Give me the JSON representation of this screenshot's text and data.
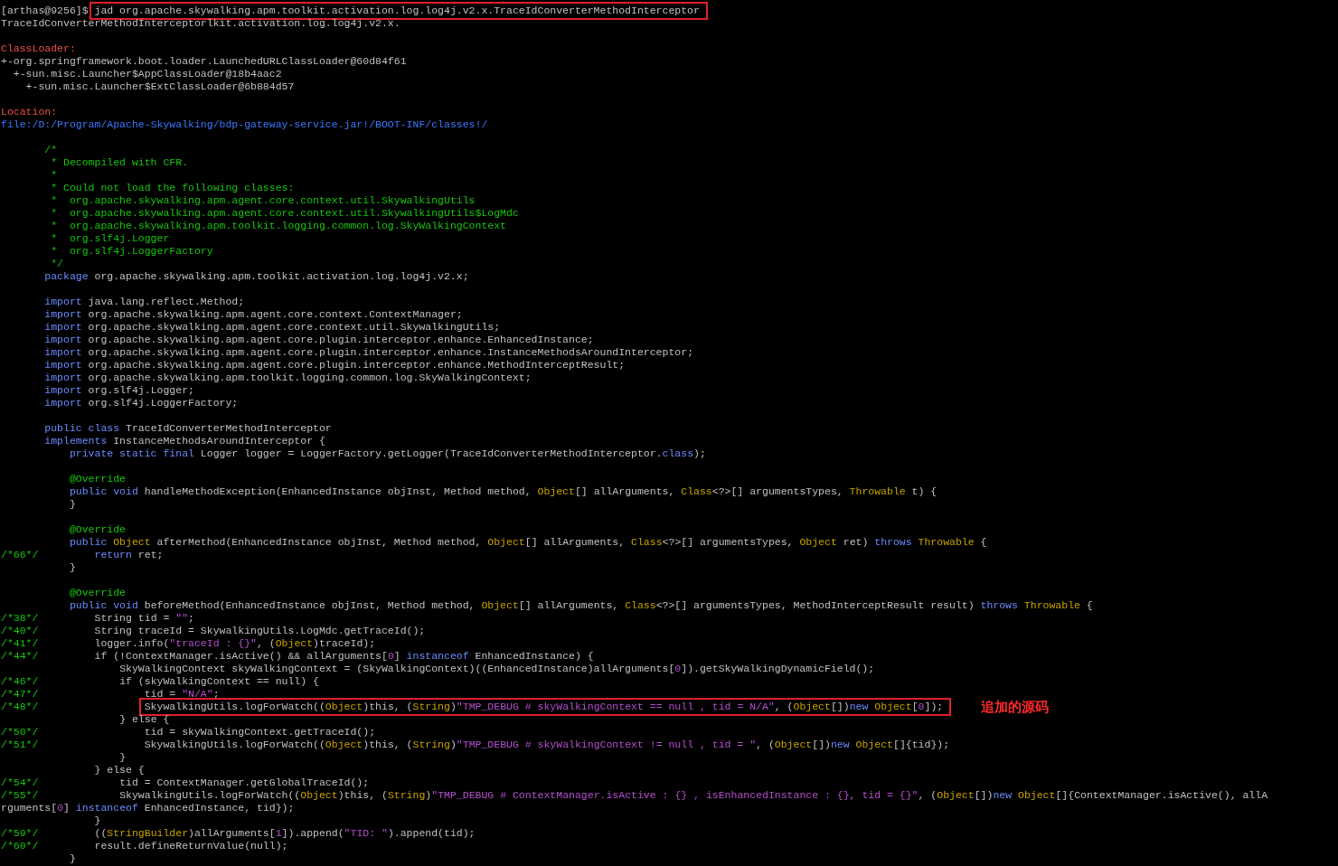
{
  "terminal": {
    "lines": [
      {
        "kind": "header",
        "prompt": "[arthas@9256]$",
        "boxed": true,
        "tokens": [
          {
            "kind": "plain",
            "text": "jad org.apache.skywalking.apm.toolkit.activation.log.log4j.v2.x.TraceIdConverterMethodInterceptor"
          }
        ]
      },
      {
        "kind": "header",
        "tokens": [
          {
            "kind": "plain",
            "text": "TraceIdConverterMethodInterceptorlkit.activation.log.log4j.v2.x."
          }
        ]
      },
      {
        "kind": "blank"
      },
      {
        "kind": "header",
        "tokens": [
          {
            "kind": "label",
            "text": "ClassLoader:"
          }
        ]
      },
      {
        "kind": "header",
        "tokens": [
          {
            "kind": "plain",
            "text": "+-org.springframework.boot.loader.LaunchedURLClassLoader@60d84f61"
          }
        ]
      },
      {
        "kind": "header",
        "tokens": [
          {
            "kind": "plain",
            "text": "  +-sun.misc.Launcher$AppClassLoader@18b4aac2"
          }
        ]
      },
      {
        "kind": "header",
        "tokens": [
          {
            "kind": "plain",
            "text": "    +-sun.misc.Launcher$ExtClassLoader@6b884d57"
          }
        ]
      },
      {
        "kind": "blank"
      },
      {
        "kind": "header",
        "tokens": [
          {
            "kind": "label",
            "text": "Location:"
          }
        ]
      },
      {
        "kind": "header",
        "tokens": [
          {
            "kind": "path",
            "text": "file:/D:/Program/Apache-Skywalking/bdp-gateway-service.jar!/BOOT-INF/classes!/"
          }
        ]
      },
      {
        "kind": "blank"
      },
      {
        "kind": "code",
        "tokens": [
          {
            "kind": "comment",
            "text": "/*"
          }
        ]
      },
      {
        "kind": "code",
        "tokens": [
          {
            "kind": "comment",
            "text": " * Decompiled with CFR."
          }
        ]
      },
      {
        "kind": "code",
        "tokens": [
          {
            "kind": "comment",
            "text": " *"
          }
        ]
      },
      {
        "kind": "code",
        "tokens": [
          {
            "kind": "comment",
            "text": " * Could not load the following classes:"
          }
        ]
      },
      {
        "kind": "code",
        "tokens": [
          {
            "kind": "comment",
            "text": " *  org.apache.skywalking.apm.agent.core.context.util.SkywalkingUtils"
          }
        ]
      },
      {
        "kind": "code",
        "tokens": [
          {
            "kind": "comment",
            "text": " *  org.apache.skywalking.apm.agent.core.context.util.SkywalkingUtils$LogMdc"
          }
        ]
      },
      {
        "kind": "code",
        "tokens": [
          {
            "kind": "comment",
            "text": " *  org.apache.skywalking.apm.toolkit.logging.common.log.SkyWalkingContext"
          }
        ]
      },
      {
        "kind": "code",
        "tokens": [
          {
            "kind": "comment",
            "text": " *  org.slf4j.Logger"
          }
        ]
      },
      {
        "kind": "code",
        "tokens": [
          {
            "kind": "comment",
            "text": " *  org.slf4j.LoggerFactory"
          }
        ]
      },
      {
        "kind": "code",
        "tokens": [
          {
            "kind": "comment",
            "text": " */"
          }
        ]
      },
      {
        "kind": "code",
        "tokens": [
          {
            "kind": "keyword",
            "text": "package"
          },
          {
            "kind": "plain",
            "text": " org.apache.skywalking.apm.toolkit.activation.log.log4j.v2.x;"
          }
        ]
      },
      {
        "kind": "blank"
      },
      {
        "kind": "code",
        "tokens": [
          {
            "kind": "keyword",
            "text": "import"
          },
          {
            "kind": "plain",
            "text": " java.lang.reflect.Method;"
          }
        ]
      },
      {
        "kind": "code",
        "tokens": [
          {
            "kind": "keyword",
            "text": "import"
          },
          {
            "kind": "plain",
            "text": " org.apache.skywalking.apm.agent.core.context.ContextManager;"
          }
        ]
      },
      {
        "kind": "code",
        "tokens": [
          {
            "kind": "keyword",
            "text": "import"
          },
          {
            "kind": "plain",
            "text": " org.apache.skywalking.apm.agent.core.context.util.SkywalkingUtils;"
          }
        ]
      },
      {
        "kind": "code",
        "tokens": [
          {
            "kind": "keyword",
            "text": "import"
          },
          {
            "kind": "plain",
            "text": " org.apache.skywalking.apm.agent.core.plugin.interceptor.enhance.EnhancedInstance;"
          }
        ]
      },
      {
        "kind": "code",
        "tokens": [
          {
            "kind": "keyword",
            "text": "import"
          },
          {
            "kind": "plain",
            "text": " org.apache.skywalking.apm.agent.core.plugin.interceptor.enhance.InstanceMethodsAroundInterceptor;"
          }
        ]
      },
      {
        "kind": "code",
        "tokens": [
          {
            "kind": "keyword",
            "text": "import"
          },
          {
            "kind": "plain",
            "text": " org.apache.skywalking.apm.agent.core.plugin.interceptor.enhance.MethodInterceptResult;"
          }
        ]
      },
      {
        "kind": "code",
        "tokens": [
          {
            "kind": "keyword",
            "text": "import"
          },
          {
            "kind": "plain",
            "text": " org.apache.skywalking.apm.toolkit.logging.common.log.SkyWalkingContext;"
          }
        ]
      },
      {
        "kind": "code",
        "tokens": [
          {
            "kind": "keyword",
            "text": "import"
          },
          {
            "kind": "plain",
            "text": " org.slf4j.Logger;"
          }
        ]
      },
      {
        "kind": "code",
        "tokens": [
          {
            "kind": "keyword",
            "text": "import"
          },
          {
            "kind": "plain",
            "text": " org.slf4j.LoggerFactory;"
          }
        ]
      },
      {
        "kind": "blank"
      },
      {
        "kind": "code",
        "tokens": [
          {
            "kind": "keyword",
            "text": "public class"
          },
          {
            "kind": "plain",
            "text": " TraceIdConverterMethodInterceptor"
          }
        ]
      },
      {
        "kind": "code",
        "tokens": [
          {
            "kind": "keyword",
            "text": "implements"
          },
          {
            "kind": "plain",
            "text": " InstanceMethodsAroundInterceptor {"
          }
        ]
      },
      {
        "kind": "code",
        "tokens": [
          {
            "kind": "keyword",
            "text": "    private static final"
          },
          {
            "kind": "plain",
            "text": " Logger logger = LoggerFactory.getLogger(TraceIdConverterMethodInterceptor."
          },
          {
            "kind": "keyword",
            "text": "class"
          },
          {
            "kind": "plain",
            "text": ");"
          }
        ]
      },
      {
        "kind": "blank"
      },
      {
        "kind": "code",
        "tokens": [
          {
            "kind": "comment",
            "text": "    @Override"
          }
        ]
      },
      {
        "kind": "code",
        "tokens": [
          {
            "kind": "keyword",
            "text": "    public void"
          },
          {
            "kind": "plain",
            "text": " handleMethodException(EnhancedInstance objInst, Method method, "
          },
          {
            "kind": "type",
            "text": "Object"
          },
          {
            "kind": "plain",
            "text": "[] allArguments, "
          },
          {
            "kind": "type",
            "text": "Class"
          },
          {
            "kind": "plain",
            "text": "<?>[] argumentsTypes, "
          },
          {
            "kind": "type",
            "text": "Throwable"
          },
          {
            "kind": "plain",
            "text": " t) {"
          }
        ]
      },
      {
        "kind": "code",
        "tokens": [
          {
            "kind": "plain",
            "text": "    }"
          }
        ]
      },
      {
        "kind": "blank"
      },
      {
        "kind": "code",
        "tokens": [
          {
            "kind": "comment",
            "text": "    @Override"
          }
        ]
      },
      {
        "kind": "code",
        "tokens": [
          {
            "kind": "keyword",
            "text": "    public "
          },
          {
            "kind": "type",
            "text": "Object"
          },
          {
            "kind": "plain",
            "text": " afterMethod(EnhancedInstance objInst, Method method, "
          },
          {
            "kind": "type",
            "text": "Object"
          },
          {
            "kind": "plain",
            "text": "[] allArguments, "
          },
          {
            "kind": "type",
            "text": "Class"
          },
          {
            "kind": "plain",
            "text": "<?>[] argumentsTypes, "
          },
          {
            "kind": "type",
            "text": "Object"
          },
          {
            "kind": "plain",
            "text": " ret) "
          },
          {
            "kind": "keyword",
            "text": "throws "
          },
          {
            "kind": "type",
            "text": "Throwable"
          },
          {
            "kind": "plain",
            "text": " {"
          }
        ]
      },
      {
        "kind": "code",
        "gutter": "/*66*/",
        "tokens": [
          {
            "kind": "keyword",
            "text": "        return"
          },
          {
            "kind": "plain",
            "text": " ret;"
          }
        ]
      },
      {
        "kind": "code",
        "tokens": [
          {
            "kind": "plain",
            "text": "    }"
          }
        ]
      },
      {
        "kind": "blank"
      },
      {
        "kind": "code",
        "tokens": [
          {
            "kind": "comment",
            "text": "    @Override"
          }
        ]
      },
      {
        "kind": "code",
        "tokens": [
          {
            "kind": "keyword",
            "text": "    public void"
          },
          {
            "kind": "plain",
            "text": " beforeMethod(EnhancedInstance objInst, Method method, "
          },
          {
            "kind": "type",
            "text": "Object"
          },
          {
            "kind": "plain",
            "text": "[] allArguments, "
          },
          {
            "kind": "type",
            "text": "Class"
          },
          {
            "kind": "plain",
            "text": "<?>[] argumentsTypes, MethodInterceptResult result) "
          },
          {
            "kind": "keyword",
            "text": "throws "
          },
          {
            "kind": "type",
            "text": "Throwable"
          },
          {
            "kind": "plain",
            "text": " {"
          }
        ]
      },
      {
        "kind": "code",
        "gutter": "/*38*/",
        "tokens": [
          {
            "kind": "plain",
            "text": "        String tid = "
          },
          {
            "kind": "string",
            "text": "\"\""
          },
          {
            "kind": "plain",
            "text": ";"
          }
        ]
      },
      {
        "kind": "code",
        "gutter": "/*40*/",
        "tokens": [
          {
            "kind": "plain",
            "text": "        String traceId = SkywalkingUtils.LogMdc.getTraceId();"
          }
        ]
      },
      {
        "kind": "code",
        "gutter": "/*41*/",
        "tokens": [
          {
            "kind": "plain",
            "text": "        logger.info("
          },
          {
            "kind": "string",
            "text": "\"traceId : {}\""
          },
          {
            "kind": "plain",
            "text": ", ("
          },
          {
            "kind": "type",
            "text": "Object"
          },
          {
            "kind": "plain",
            "text": ")traceId);"
          }
        ]
      },
      {
        "kind": "code",
        "gutter": "/*44*/",
        "tokens": [
          {
            "kind": "plain",
            "text": "        if (!ContextManager.isActive() && allArguments["
          },
          {
            "kind": "number",
            "text": "0"
          },
          {
            "kind": "plain",
            "text": "] "
          },
          {
            "kind": "keyword",
            "text": "instanceof"
          },
          {
            "kind": "plain",
            "text": " EnhancedInstance) {"
          }
        ]
      },
      {
        "kind": "code",
        "tokens": [
          {
            "kind": "plain",
            "text": "            SkyWalkingContext skyWalkingContext = (SkyWalkingContext)((EnhancedInstance)allArguments["
          },
          {
            "kind": "number",
            "text": "0"
          },
          {
            "kind": "plain",
            "text": "]).getSkyWalkingDynamicField();"
          }
        ]
      },
      {
        "kind": "code",
        "gutter": "/*46*/",
        "tokens": [
          {
            "kind": "plain",
            "text": "            if (skyWalkingContext == null) {"
          }
        ]
      },
      {
        "kind": "code",
        "gutter": "/*47*/",
        "tokens": [
          {
            "kind": "plain",
            "text": "                tid = "
          },
          {
            "kind": "string",
            "text": "\"N/A\""
          },
          {
            "kind": "plain",
            "text": ";"
          }
        ]
      },
      {
        "kind": "code",
        "gutter": "/*48*/",
        "boxed": true,
        "note": "追加的源码",
        "tokens": [
          {
            "kind": "plain",
            "text": "                SkywalkingUtils.logForWatch(("
          },
          {
            "kind": "type",
            "text": "Object"
          },
          {
            "kind": "plain",
            "text": ")this, ("
          },
          {
            "kind": "type",
            "text": "String"
          },
          {
            "kind": "plain",
            "text": ")"
          },
          {
            "kind": "string",
            "text": "\"TMP_DEBUG # skyWalkingContext == null , tid = N/A\""
          },
          {
            "kind": "plain",
            "text": ", ("
          },
          {
            "kind": "type",
            "text": "Object"
          },
          {
            "kind": "plain",
            "text": "[])"
          },
          {
            "kind": "keyword",
            "text": "new "
          },
          {
            "kind": "type",
            "text": "Object"
          },
          {
            "kind": "plain",
            "text": "["
          },
          {
            "kind": "number",
            "text": "0"
          },
          {
            "kind": "plain",
            "text": "]);"
          }
        ]
      },
      {
        "kind": "code",
        "tokens": [
          {
            "kind": "plain",
            "text": "            } else {"
          }
        ]
      },
      {
        "kind": "code",
        "gutter": "/*50*/",
        "tokens": [
          {
            "kind": "plain",
            "text": "                tid = skyWalkingContext.getTraceId();"
          }
        ]
      },
      {
        "kind": "code",
        "gutter": "/*51*/",
        "tokens": [
          {
            "kind": "plain",
            "text": "                SkywalkingUtils.logForWatch(("
          },
          {
            "kind": "type",
            "text": "Object"
          },
          {
            "kind": "plain",
            "text": ")this, ("
          },
          {
            "kind": "type",
            "text": "String"
          },
          {
            "kind": "plain",
            "text": ")"
          },
          {
            "kind": "string",
            "text": "\"TMP_DEBUG # skyWalkingContext != null , tid = \""
          },
          {
            "kind": "plain",
            "text": ", ("
          },
          {
            "kind": "type",
            "text": "Object"
          },
          {
            "kind": "plain",
            "text": "[])"
          },
          {
            "kind": "keyword",
            "text": "new "
          },
          {
            "kind": "type",
            "text": "Object"
          },
          {
            "kind": "plain",
            "text": "[]{tid});"
          }
        ]
      },
      {
        "kind": "code",
        "tokens": [
          {
            "kind": "plain",
            "text": "            }"
          }
        ]
      },
      {
        "kind": "code",
        "tokens": [
          {
            "kind": "plain",
            "text": "        } else {"
          }
        ]
      },
      {
        "kind": "code",
        "gutter": "/*54*/",
        "tokens": [
          {
            "kind": "plain",
            "text": "            tid = ContextManager.getGlobalTraceId();"
          }
        ]
      },
      {
        "kind": "code",
        "gutter": "/*55*/",
        "tokens": [
          {
            "kind": "plain",
            "text": "            SkywalkingUtils.logForWatch(("
          },
          {
            "kind": "type",
            "text": "Object"
          },
          {
            "kind": "plain",
            "text": ")this, ("
          },
          {
            "kind": "type",
            "text": "String"
          },
          {
            "kind": "plain",
            "text": ")"
          },
          {
            "kind": "string",
            "text": "\"TMP_DEBUG # ContextManager.isActive : {} , isEnhancedInstance : {}, tid = {}\""
          },
          {
            "kind": "plain",
            "text": ", ("
          },
          {
            "kind": "type",
            "text": "Object"
          },
          {
            "kind": "plain",
            "text": "[])"
          },
          {
            "kind": "keyword",
            "text": "new "
          },
          {
            "kind": "type",
            "text": "Object"
          },
          {
            "kind": "plain",
            "text": "[]{ContextManager.isActive(), allA"
          }
        ]
      },
      {
        "kind": "header",
        "tokens": [
          {
            "kind": "plain",
            "text": "rguments["
          },
          {
            "kind": "number",
            "text": "0"
          },
          {
            "kind": "plain",
            "text": "] "
          },
          {
            "kind": "keyword",
            "text": "instanceof"
          },
          {
            "kind": "plain",
            "text": " EnhancedInstance, tid});"
          }
        ]
      },
      {
        "kind": "code",
        "tokens": [
          {
            "kind": "plain",
            "text": "        }"
          }
        ]
      },
      {
        "kind": "code",
        "gutter": "/*59*/",
        "tokens": [
          {
            "kind": "plain",
            "text": "        (("
          },
          {
            "kind": "type",
            "text": "StringBuilder"
          },
          {
            "kind": "plain",
            "text": ")allArguments["
          },
          {
            "kind": "number",
            "text": "1"
          },
          {
            "kind": "plain",
            "text": "]).append("
          },
          {
            "kind": "string",
            "text": "\"TID: \""
          },
          {
            "kind": "plain",
            "text": ").append(tid);"
          }
        ]
      },
      {
        "kind": "code",
        "gutter": "/*60*/",
        "tokens": [
          {
            "kind": "plain",
            "text": "        result.defineReturnValue(null);"
          }
        ]
      },
      {
        "kind": "code",
        "tokens": [
          {
            "kind": "plain",
            "text": "    }"
          }
        ]
      }
    ]
  }
}
